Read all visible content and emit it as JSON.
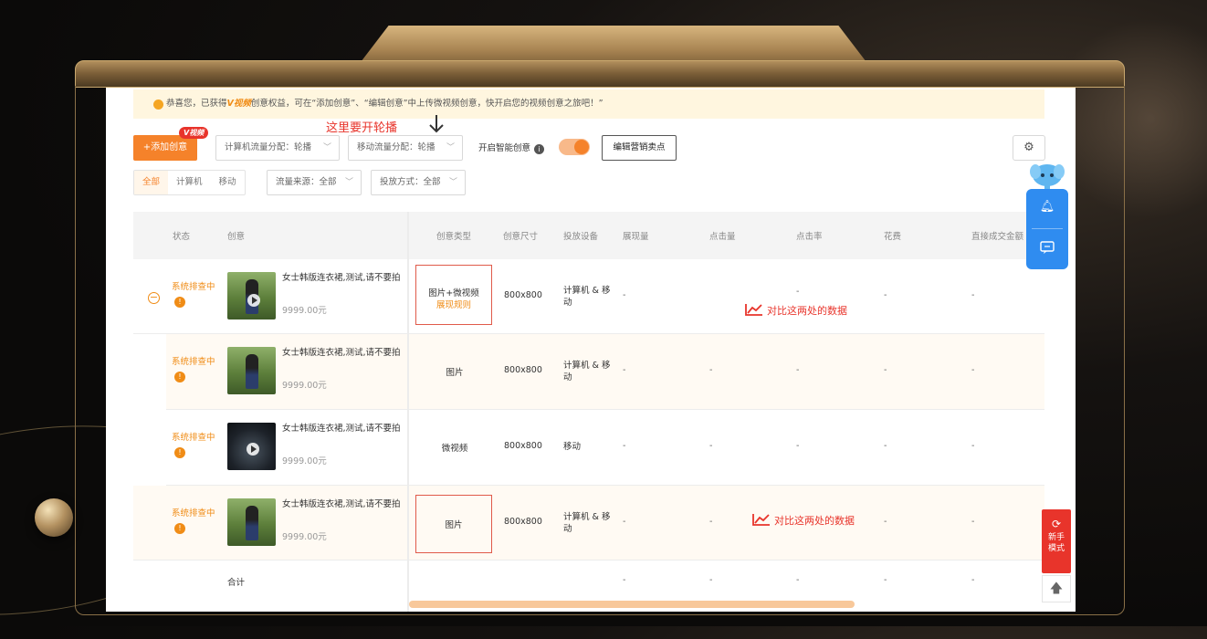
{
  "notice": {
    "prefix": "恭喜您，已获得",
    "brand": "V视频",
    "middle": "创意权益，可在“添加创意”、“编辑创意”中上传微视频创意，快开启您的视频创意之旅吧！”"
  },
  "annotation_top": "这里要开轮播",
  "toolbar": {
    "add_label": "+添加创意",
    "vbadge": "V视频",
    "pc_traffic": "计算机流量分配：轮播",
    "mobile_traffic": "移动流量分配：轮播",
    "smart_label": "开启智能创意",
    "edit_label": "编辑营销卖点",
    "settings_icon": "gear-icon"
  },
  "filters": {
    "seg": [
      "全部",
      "计算机",
      "移动"
    ],
    "source": "流量来源：全部",
    "delivery": "投放方式：全部"
  },
  "table": {
    "headers": [
      "状态",
      "创意",
      "创意类型",
      "创意尺寸",
      "投放设备",
      "展现量",
      "点击量",
      "点击率",
      "花费",
      "直接成交金额"
    ],
    "rows": [
      {
        "status": "系统排查中",
        "name": "女士韩版连衣裙,测试,请不要拍",
        "price": "9999.00元",
        "type1": "图片+微视频",
        "type2": "展现规则",
        "size": "800x800",
        "device": "计算机 & 移动",
        "impr": "-",
        "click": "-",
        "ctr": "-",
        "cost": "-",
        "gmv": "-"
      },
      {
        "status": "系统排查中",
        "name": "女士韩版连衣裙,测试,请不要拍",
        "price": "9999.00元",
        "type1": "图片",
        "size": "800x800",
        "device": "计算机 & 移动",
        "impr": "-",
        "click": "-",
        "ctr": "-",
        "cost": "-",
        "gmv": "-"
      },
      {
        "status": "系统排查中",
        "name": "女士韩版连衣裙,测试,请不要拍",
        "price": "9999.00元",
        "type1": "微视频",
        "size": "800x800",
        "device": "移动",
        "impr": "-",
        "click": "-",
        "ctr": "-",
        "cost": "-",
        "gmv": "-"
      },
      {
        "status": "系统排查中",
        "name": "女士韩版连衣裙,测试,请不要拍",
        "price": "9999.00元",
        "type1": "图片",
        "size": "800x800",
        "device": "计算机 & 移动",
        "impr": "-",
        "click": "-",
        "cost": "-",
        "gmv": "-"
      }
    ],
    "total_label": "合计",
    "total_values": [
      "-",
      "-",
      "-",
      "-",
      "-"
    ]
  },
  "annotation_compare_1": "对比这两处的数据",
  "annotation_compare_2": "对比这两处的数据",
  "float": {
    "newbie_line1": "新手",
    "newbie_line2": "模式",
    "up_arrow": "🡅"
  },
  "colors": {
    "accent": "#f5822a",
    "annotation": "#e8342b",
    "float_blue": "#2f8cf0"
  }
}
